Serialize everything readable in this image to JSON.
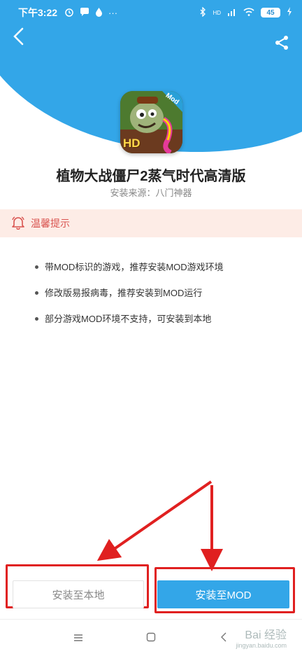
{
  "status_bar": {
    "time": "下午3:22",
    "network": "HD",
    "battery": "45",
    "more": "···"
  },
  "app": {
    "title": "植物大战僵尸2蒸气时代高清版",
    "source": "安装来源：八门神器",
    "icon_tags": {
      "mod": "Mod",
      "hd": "HD"
    }
  },
  "notice": {
    "label": "温馨提示"
  },
  "tips": [
    "带MOD标识的游戏，推荐安装MOD游戏环境",
    "修改版易报病毒，推荐安装到MOD运行",
    "部分游戏MOD环境不支持，可安装到本地"
  ],
  "buttons": {
    "install_local": "安装至本地",
    "install_mod": "安装至MOD"
  },
  "watermark": {
    "main": "Bai 经验",
    "sub": "jingyan.baidu.com"
  },
  "colors": {
    "accent": "#33a6e8",
    "notice_bg": "#fdece6",
    "notice_text": "#d9534f",
    "annotation": "#e02020"
  }
}
